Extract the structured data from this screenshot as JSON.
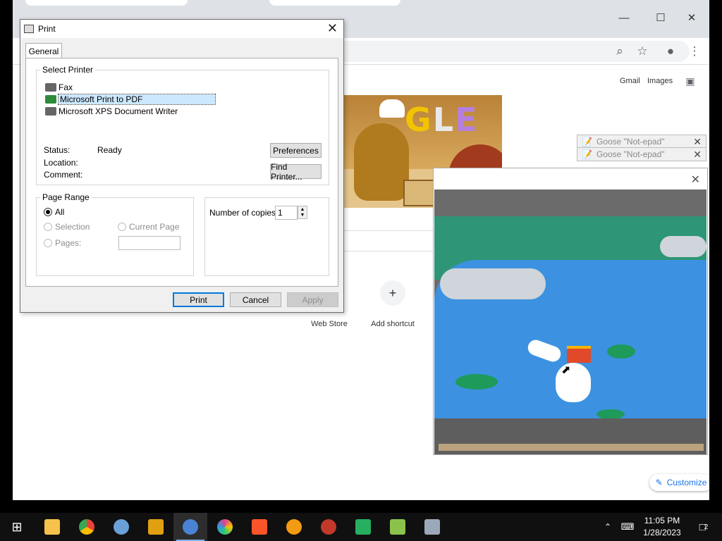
{
  "chrome": {
    "gmail": "Gmail",
    "images": "Images",
    "shortcuts": [
      {
        "label": "Web Store"
      },
      {
        "label": "Add shortcut",
        "icon": "+"
      }
    ],
    "customize": "Customize"
  },
  "notepads": [
    {
      "title": "Goose \"Not-epad\""
    },
    {
      "title": "Goose \"Not-epad\""
    }
  ],
  "print_dialog": {
    "title": "Print",
    "tab": "General",
    "select_printer_label": "Select Printer",
    "printers": [
      {
        "name": "Fax",
        "selected": false
      },
      {
        "name": "Microsoft Print to PDF",
        "selected": true
      },
      {
        "name": "Microsoft XPS Document Writer",
        "selected": false
      }
    ],
    "status_label": "Status:",
    "status_value": "Ready",
    "location_label": "Location:",
    "comment_label": "Comment:",
    "preferences": "Preferences",
    "find_printer": "Find Printer...",
    "page_range_label": "Page Range",
    "range_all": "All",
    "range_selection": "Selection",
    "range_current": "Current Page",
    "range_pages": "Pages:",
    "copies_label": "Number of copies:",
    "copies_value": "1",
    "print": "Print",
    "cancel": "Cancel",
    "apply": "Apply"
  },
  "taskbar": {
    "time": "11:05 PM",
    "date": "1/28/2023",
    "notifications": "2",
    "apps": [
      {
        "name": "start",
        "color": "#ffffff"
      },
      {
        "name": "file-explorer",
        "color": "#f7c24b"
      },
      {
        "name": "chrome",
        "color": "#34a853"
      },
      {
        "name": "safari",
        "color": "#6aa0d8"
      },
      {
        "name": "maps-app",
        "color": "#e0a010"
      },
      {
        "name": "chromium",
        "color": "#4a82d4"
      },
      {
        "name": "color-app",
        "color": "#e04090"
      },
      {
        "name": "brave",
        "color": "#fb542b"
      },
      {
        "name": "pdf-app",
        "color": "#f39c12"
      },
      {
        "name": "opera-app",
        "color": "#c0392b"
      },
      {
        "name": "a-app",
        "color": "#27ae60"
      },
      {
        "name": "green-app",
        "color": "#8bc34a"
      },
      {
        "name": "goose-app",
        "color": "#9aa8b8"
      }
    ]
  }
}
